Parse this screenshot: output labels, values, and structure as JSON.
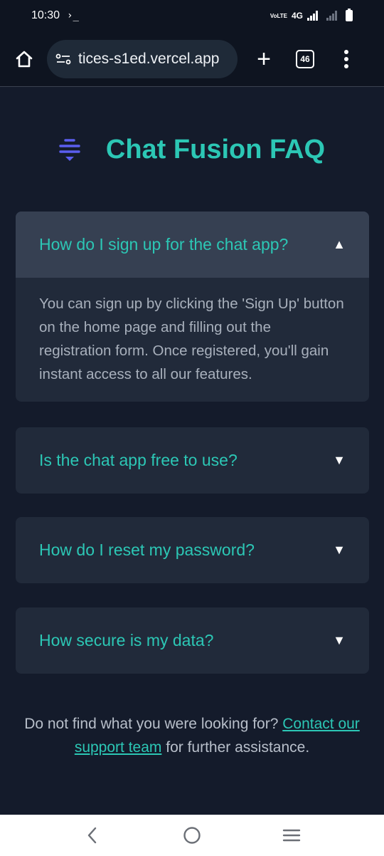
{
  "status_bar": {
    "time": "10:30",
    "terminal_glyph": "›_",
    "network": "4G",
    "volte": "VoLTE"
  },
  "browser": {
    "url": "tices-s1ed.vercel.app",
    "tab_count": "46",
    "new_tab_symbol": "+"
  },
  "page": {
    "title": "Chat Fusion FAQ",
    "logo_icon": "filter-lines-icon",
    "faqs": [
      {
        "question": "How do I sign up for the chat app?",
        "answer": "You can sign up by clicking the 'Sign Up' button on the home page and filling out the registration form. Once registered, you'll gain instant access to all our features.",
        "expanded": true,
        "arrow": "▲"
      },
      {
        "question": "Is the chat app free to use?",
        "expanded": false,
        "arrow": "▼"
      },
      {
        "question": "How do I reset my password?",
        "expanded": false,
        "arrow": "▼"
      },
      {
        "question": "How secure is my data?",
        "expanded": false,
        "arrow": "▼"
      }
    ],
    "footer": {
      "prefix": "Do not find what you were looking for? ",
      "link": "Contact our support team",
      "suffix": " for further assistance."
    }
  },
  "colors": {
    "accent": "#2cc7b5",
    "logo": "#5b5ef0",
    "background": "#141b2b",
    "card": "#212a3a",
    "card_open_header": "#364052"
  }
}
